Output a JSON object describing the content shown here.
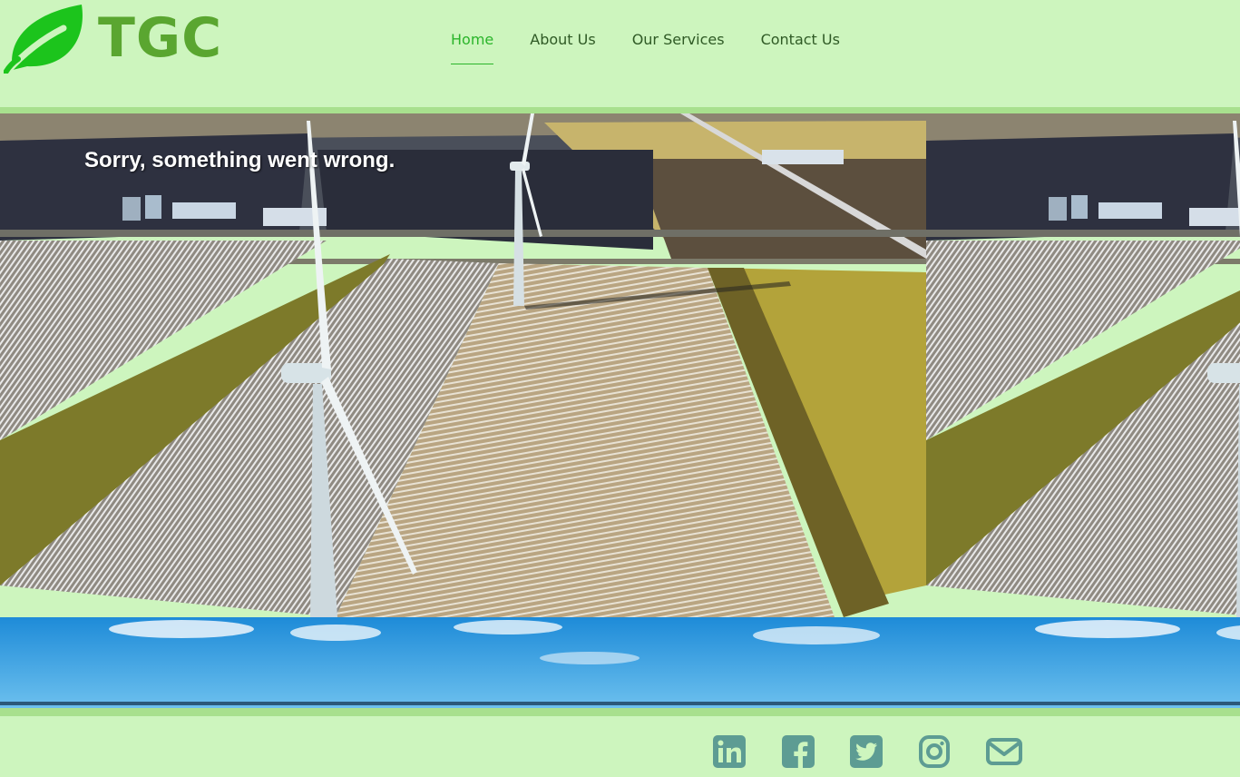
{
  "logo": {
    "text": "TGC",
    "icon": "leaf-icon",
    "color": "#5aa630",
    "leaf_color": "#1cc41c"
  },
  "nav": {
    "items": [
      {
        "label": "Home",
        "active": true
      },
      {
        "label": "About Us",
        "active": false
      },
      {
        "label": "Our Services",
        "active": false
      },
      {
        "label": "Contact Us",
        "active": false
      }
    ],
    "active_color": "#2bb52b",
    "text_color": "#2f5a25"
  },
  "hero": {
    "error_message": "Sorry, something went wrong.",
    "image": "aerial-wind-turbines-farmland",
    "tiled": true
  },
  "footer": {
    "social_icons": [
      {
        "name": "linkedin-icon"
      },
      {
        "name": "facebook-icon"
      },
      {
        "name": "twitter-icon"
      },
      {
        "name": "instagram-icon"
      },
      {
        "name": "email-icon"
      }
    ],
    "icon_color": "#5d9c93"
  },
  "colors": {
    "background": "#cdf5be",
    "strip": "#a8e08e"
  }
}
